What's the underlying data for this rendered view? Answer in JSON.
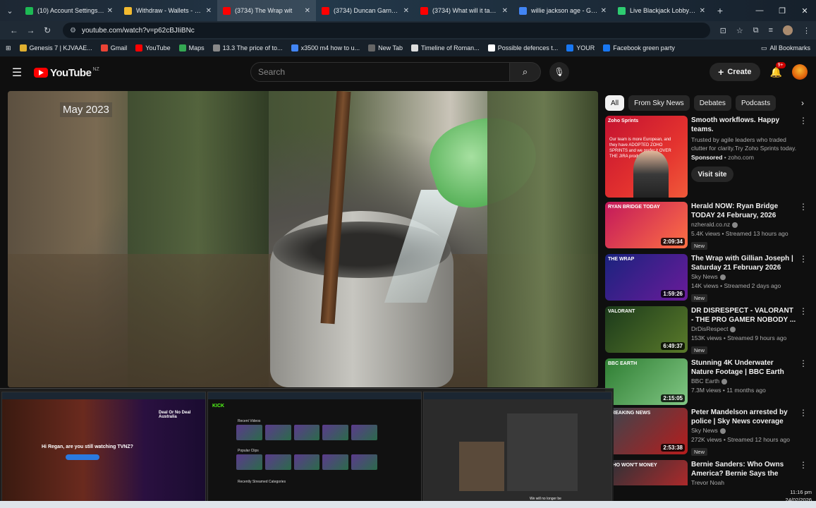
{
  "browser": {
    "tabs": [
      {
        "label": "(10) Account Settings / S",
        "color": "#1db954",
        "active": false
      },
      {
        "label": "Withdraw - Wallets - Bin",
        "color": "#f3ba2f",
        "active": false
      },
      {
        "label": "(3734) The Wrap wit",
        "color": "#ff0000",
        "active": true
      },
      {
        "label": "(3734) Duncan Garner R",
        "color": "#ff0000",
        "active": false
      },
      {
        "label": "(3734) What will it take f",
        "color": "#ff0000",
        "active": false
      },
      {
        "label": "willie jackson age - Goo",
        "color": "#4285f4",
        "active": false
      },
      {
        "label": "Live Blackjack Lobby - P",
        "color": "#2ecc71",
        "active": false
      }
    ],
    "url": "youtube.com/watch?v=p62cBJIiBNc",
    "bookmarks": [
      {
        "label": "Genesis 7 | KJVAAE...",
        "color": "#e0b030"
      },
      {
        "label": "Gmail",
        "color": "#ea4335"
      },
      {
        "label": "YouTube",
        "color": "#ff0000"
      },
      {
        "label": "Maps",
        "color": "#34a853"
      },
      {
        "label": "13.3 The price of to...",
        "color": "#888888"
      },
      {
        "label": "x3500 m4 how to u...",
        "color": "#4285f4"
      },
      {
        "label": "New Tab",
        "color": "#666666"
      },
      {
        "label": "Timeline of Roman...",
        "color": "#dddddd"
      },
      {
        "label": "Possible defences t...",
        "color": "#ffffff"
      },
      {
        "label": "YOUR",
        "color": "#1877f2"
      },
      {
        "label": "Facebook green party",
        "color": "#1877f2"
      }
    ],
    "all_bookmarks": "All Bookmarks"
  },
  "youtube": {
    "logo": "YouTube",
    "region": "NZ",
    "search_placeholder": "Search",
    "create": "Create",
    "notif_count": "9+"
  },
  "video": {
    "caption": "May 2023"
  },
  "chips": [
    "All",
    "From Sky News",
    "Debates",
    "Podcasts"
  ],
  "ad": {
    "title": "Smooth workflows. Happy teams.",
    "desc": "Trusted by agile leaders who traded clutter for clarity.Try Zoho Sprints today.",
    "sponsored": "Sponsored",
    "domain": "zoho.com",
    "cta": "Visit site",
    "thumb_brand": "Zoho Sprints",
    "thumb_text": "Our team is more European, and they have ADOPTED ZOHO SPRINTS and we prefer it OVER THE JIRA product."
  },
  "recommendations": [
    {
      "title": "Herald NOW: Ryan Bridge TODAY 24 February, 2026",
      "channel": "nzherald.co.nz",
      "meta": "5.4K views • Streamed 13 hours ago",
      "duration": "2:09:34",
      "new": "New",
      "verified": true,
      "thumb_label": "RYAN BRIDGE TODAY",
      "colors": [
        "#c2185b",
        "#ff7043"
      ]
    },
    {
      "title": "The Wrap with Gillian Joseph | Saturday 21 February 2026",
      "channel": "Sky News",
      "meta": "14K views • Streamed 2 days ago",
      "duration": "1:59:26",
      "new": "New",
      "verified": true,
      "thumb_label": "THE WRAP",
      "colors": [
        "#1a237e",
        "#6a1b9a"
      ]
    },
    {
      "title": "DR DISRESPECT - VALORANT - THE PRO GAMER NOBODY ...",
      "channel": "DrDisRespect",
      "meta": "153K views • Streamed 9 hours ago",
      "duration": "6:49:37",
      "new": "New",
      "verified": true,
      "thumb_label": "VALORANT",
      "colors": [
        "#1b3a1b",
        "#5a7a2a"
      ]
    },
    {
      "title": "Stunning 4K Underwater Nature Footage | BBC Earth",
      "channel": "BBC Earth",
      "meta": "7.3M views • 11 months ago",
      "duration": "2:15:05",
      "new": "",
      "verified": true,
      "thumb_label": "BBC EARTH",
      "colors": [
        "#2e7d32",
        "#81c784"
      ]
    },
    {
      "title": "Peter Mandelson arrested by police | Sky News coverage",
      "channel": "Sky News",
      "meta": "272K views • Streamed 12 hours ago",
      "duration": "2:53:38",
      "new": "New",
      "verified": true,
      "thumb_label": "BREAKING NEWS",
      "colors": [
        "#37474f",
        "#b71c1c"
      ]
    },
    {
      "title": "Bernie Sanders: Who Owns America? Bernie Says the Quie...",
      "channel": "Trevor Noah",
      "meta": "",
      "duration": "",
      "new": "",
      "verified": false,
      "thumb_label": "WHO WON'T MONEY",
      "colors": [
        "#263238",
        "#c62828"
      ]
    }
  ],
  "previews": {
    "p1_message": "Hi Regan, are you still watching TVNZ?",
    "p1_brand": "Deal Or No Deal Australia",
    "p2_brand": "KICK",
    "p2_sections": [
      "Recent Videos",
      "Popular Clips",
      "Recently Streamed Categories"
    ],
    "p3_note": "We will no longer be"
  },
  "clock": {
    "time": "11:16 pm",
    "date": "24/02/2026"
  }
}
